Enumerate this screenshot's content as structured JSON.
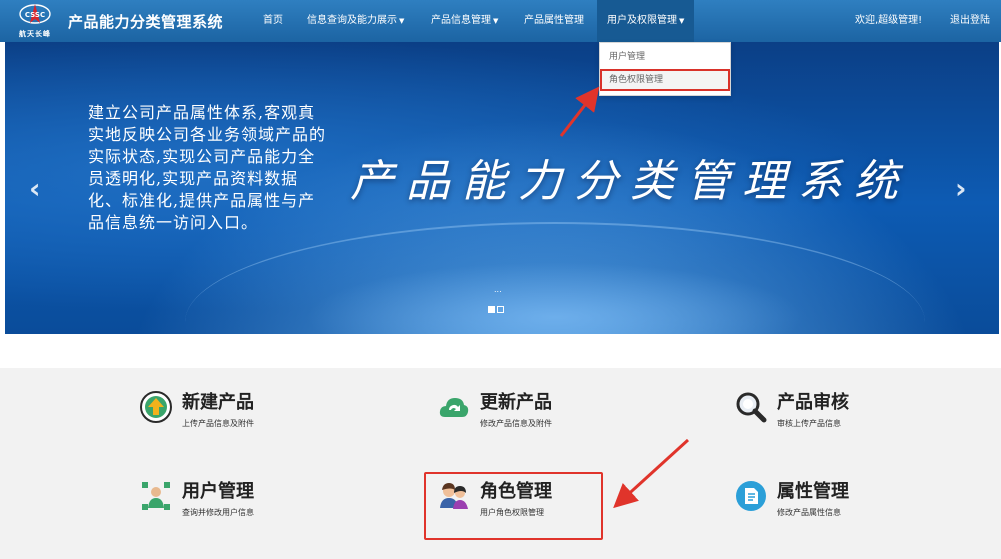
{
  "app": {
    "logo_text": "CSSC",
    "logo_sub": "航天长峰",
    "title": "产品能力分类管理系统"
  },
  "nav": {
    "home": "首页",
    "info_query": "信息查询及能力展示",
    "product_info": "产品信息管理",
    "product_attr": "产品属性管理",
    "user_perm": "用户及权限管理",
    "welcome": "欢迎,超级管理!",
    "logout": "退出登陆"
  },
  "dropdown": {
    "items": [
      "用户管理",
      "角色权限管理"
    ]
  },
  "banner": {
    "slogan": "建立公司产品属性体系,客观真实地反映公司各业务领域产品的实际状态,实现公司产品能力全员透明化,实现产品资料数据化、标准化,提供产品属性与产品信息统一访问入口。",
    "title": "产品能力分类管理系统",
    "prev": "‹",
    "next": "›",
    "ellipsis": "..."
  },
  "features": [
    {
      "title": "新建产品",
      "sub": "上传产品信息及附件",
      "icon": "upload-icon",
      "color": "#2b7fc2"
    },
    {
      "title": "更新产品",
      "sub": "修改产品信息及附件",
      "icon": "refresh-cloud-icon",
      "color": "#3aa56b"
    },
    {
      "title": "产品审核",
      "sub": "审核上传产品信息",
      "icon": "magnifier-icon",
      "color": "#2b6fb7"
    },
    {
      "title": "用户管理",
      "sub": "查询并修改用户信息",
      "icon": "users-icon",
      "color": "#3aa56b"
    },
    {
      "title": "角色管理",
      "sub": "用户角色权限管理",
      "icon": "role-icon",
      "color": "#d05a3a"
    },
    {
      "title": "属性管理",
      "sub": "修改产品属性信息",
      "icon": "document-icon",
      "color": "#2b9fd8"
    }
  ],
  "colors": {
    "nav_bg": "#1c64a3",
    "highlight": "#e0342b"
  }
}
